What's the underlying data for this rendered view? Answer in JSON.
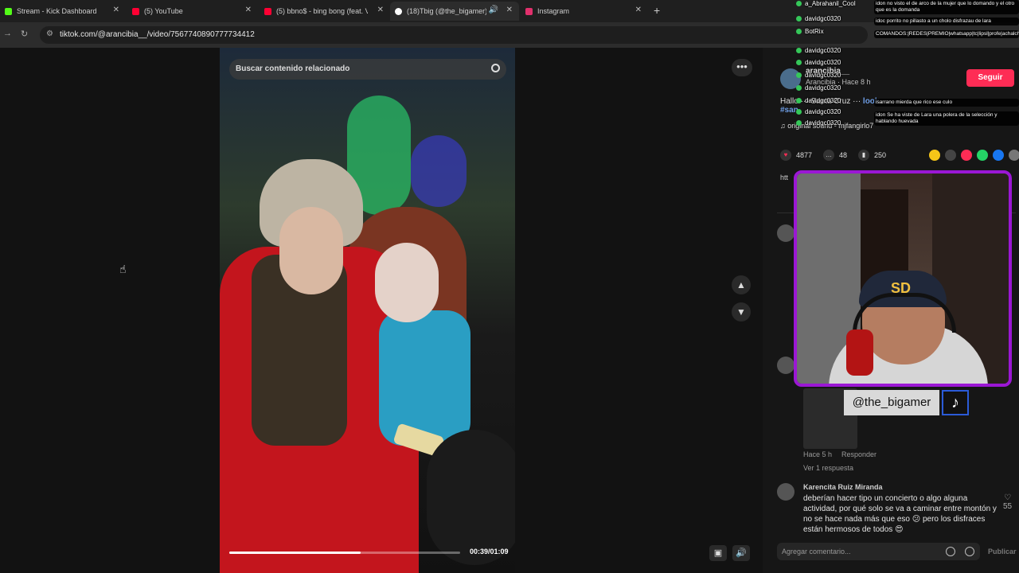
{
  "tabs": [
    {
      "label": "Stream - Kick Dashboard",
      "icon": "kick-icon",
      "color": "#53fc18"
    },
    {
      "label": "(5) YouTube",
      "icon": "youtube-icon",
      "color": "#ff0033"
    },
    {
      "label": "(5) bbno$ - bing bong (feat. Vl",
      "icon": "youtube-icon",
      "color": "#ff0033"
    },
    {
      "label": "(18)Tbig (@the_bigamer) | T",
      "icon": "tiktok-icon",
      "color": "#ffffff"
    },
    {
      "label": "Instagram",
      "icon": "instagram-icon",
      "color": "#e1306c"
    }
  ],
  "address": {
    "url": "tiktok.com/@arancibia__/video/7567740890777734412"
  },
  "video": {
    "search_placeholder": "Buscar contenido relacionado",
    "time": "00:39/01:09",
    "progress_fraction": 0.57
  },
  "post": {
    "author": "arancibia__",
    "author_sub": "Arancibia · Hace 8 h",
    "follow_label": "Seguir",
    "desc_prefix": "Hallo",
    "desc_mid": "Santa Cruz",
    "desc_tail": "look",
    "hashtags": "#san",
    "sound": "♫ original sound - mjfangirlo7",
    "likes": "4877",
    "comments": "48",
    "saves": "250",
    "link_fragment": "htt"
  },
  "comments": [
    {
      "time": "Hace 5 h",
      "reply": "Responder",
      "view_replies": "Ver 1 respuesta"
    },
    {
      "user": "Karencita Ruiz Miranda",
      "text": "deberían hacer tipo un concierto o algo alguna actividad, por qué solo se va a caminar entre montón y no se hace nada más que eso 😕 pero los disfraces están hermosos de todos 😍",
      "likes": "55"
    }
  ],
  "comment_input": {
    "placeholder": "Agregar comentario...",
    "publish": "Publicar"
  },
  "chat": {
    "users": [
      "a_Abrahanil_Cool",
      "davidgc0320",
      "BotRix",
      "davidgc0320",
      "davidgc0320",
      "davidgc0320",
      "davidgc0320",
      "davidgc0320",
      "davidgc0320",
      "davidgc0320"
    ],
    "messages": [
      "idon no visto el de arco de la mujer que lo domando y el otro que es la domanda",
      "idoc porrito no pillasto a un cholo disfrazau de lara",
      "COMANDOS:|REDES|PREMIO|whatsapp|tc|lipsl|profe|achalchaman",
      "isarrano mierda que rico ese culo",
      "idon Se ha viste de Lara una polera de la selección y hablando huevada"
    ]
  },
  "streamer": {
    "handle": "@the_bigamer",
    "cap_logo": "SD"
  }
}
